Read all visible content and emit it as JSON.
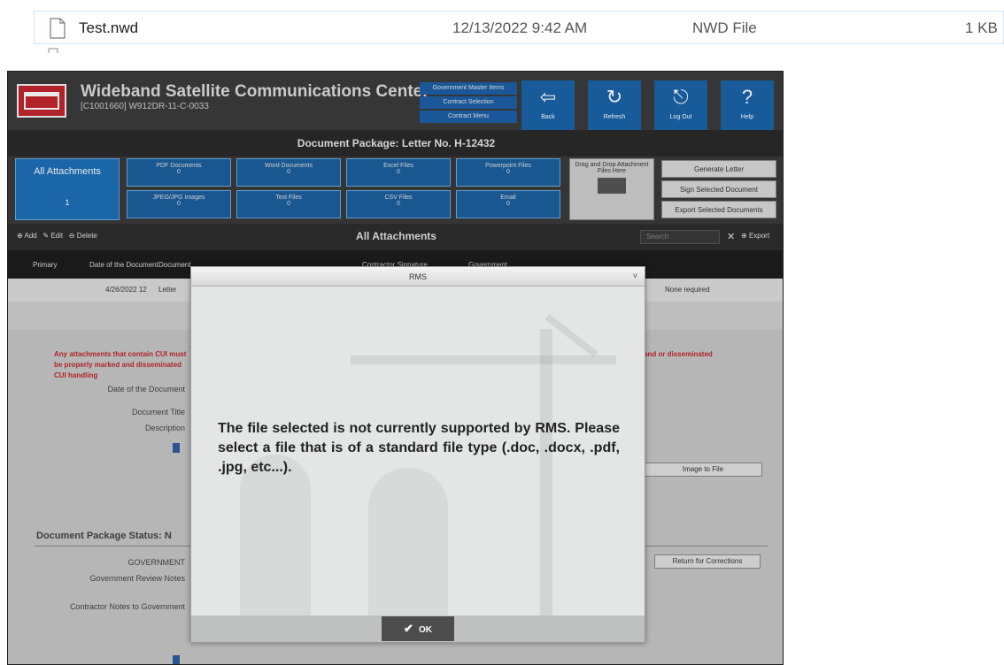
{
  "explorer": {
    "file_name": "Test.nwd",
    "date_modified": "12/13/2022 9:42 AM",
    "file_type": "NWD File",
    "file_size": "1 KB"
  },
  "app": {
    "title": "Wideband Satellite Communications Center",
    "subtitle": "[C1001660] W912DR-11-C-0033",
    "header_links": [
      "Government Master Items",
      "Contract Selection",
      "Contract Menu"
    ],
    "nav_buttons": [
      {
        "label": "Back",
        "icon": "back-arrow-icon"
      },
      {
        "label": "Refresh",
        "icon": "refresh-icon"
      },
      {
        "label": "Log Out",
        "icon": "logout-icon"
      },
      {
        "label": "Help",
        "icon": "help-icon"
      }
    ],
    "package_title": "Document Package: Letter No. H-12432",
    "categories": {
      "all": {
        "label": "All Attachments",
        "count": "1"
      },
      "pdf": {
        "label": "PDF Documents",
        "count": "0"
      },
      "word": {
        "label": "Word Documents",
        "count": "0"
      },
      "excel": {
        "label": "Excel Files",
        "count": "0"
      },
      "ppt": {
        "label": "Powerpoint Files",
        "count": "0"
      },
      "jpeg": {
        "label": "JPEG/JPG Images",
        "count": "0"
      },
      "text": {
        "label": "Text Files",
        "count": "0"
      },
      "csv": {
        "label": "CSV Files",
        "count": "0"
      },
      "email": {
        "label": "Email",
        "count": "0"
      }
    },
    "drag_drop": "Drag and Drop Attachment Files Here",
    "side_buttons": [
      "Generate Letter",
      "Sign Selected Document",
      "Export Selected Documents"
    ],
    "toolbar": {
      "add": "Add",
      "edit": "Edit",
      "delete": "Delete",
      "section_title": "All Attachments",
      "search_placeholder": "Search",
      "clear": "✕",
      "export": "Export"
    },
    "table_headers": [
      "Primary",
      "Date of the Document",
      "Document",
      "Contractor Signature",
      "Government"
    ],
    "row": {
      "date": "4/26/2022 12",
      "title": "Letter",
      "status": "None required"
    },
    "warning_text_left": "Any attachments that contain CUI must be properly marked and disseminated CUI handling",
    "warning_text_right": "and or disseminated",
    "form_labels": [
      "Date of the Document",
      "Document Title",
      "Description"
    ],
    "image_button": "Image to File",
    "status_section": "Document Package Status: N",
    "status_labels": [
      "GOVERNMENT",
      "Government Review Notes",
      "Contractor Notes to Government"
    ],
    "return_button": "Return for Corrections"
  },
  "modal": {
    "title": "RMS",
    "close": "˅",
    "message": "The file selected is not currently supported by RMS. Please select a file that is of a standard file type (.doc, .docx, .pdf, .jpg, etc...).",
    "ok_label": "OK"
  }
}
